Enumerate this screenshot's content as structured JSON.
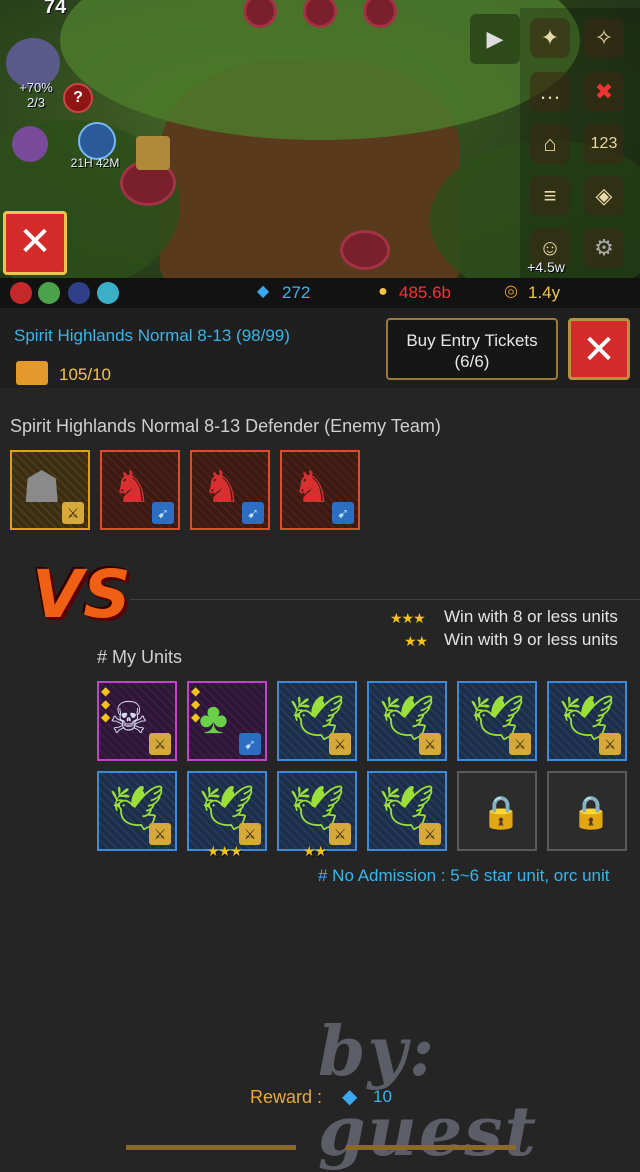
{
  "scene": {
    "level": "74",
    "boost_percent": "+70%",
    "boost_count": "2/3",
    "help_icon": "?",
    "timer": "21H 42M",
    "floating_gain": "+4.5w",
    "close_glyph": "✕"
  },
  "currency": {
    "gems": "272",
    "medals": "485.6b",
    "gold": "1.4y",
    "gem_icon": "gem-icon",
    "medal_icon": "medal-icon",
    "gold_icon": "gold-coin-icon"
  },
  "dungeon": {
    "title": "Spirit Highlands Normal 8-13 (98/99)",
    "tickets": "105/10",
    "buy_label": "Buy Entry Tickets",
    "buy_count": "(6/6)",
    "close_glyph": "✕"
  },
  "enemy": {
    "heading": "Spirit Highlands Normal 8-13 Defender (Enemy Team)"
  },
  "vs_label": "VS",
  "rules": {
    "three_star": "Win with 8 or less units",
    "two_star": "Win with 9 or less units",
    "three_star_icon": "★★★",
    "two_star_icon": "★★"
  },
  "my_units": {
    "heading": "# My Units",
    "row1_stars": "★★★",
    "row2_stars": "★★"
  },
  "restriction": "# No Admission : 5~6 star unit, orc unit",
  "reward": {
    "label": "Reward :",
    "value": "10"
  },
  "watermark": "by: guest",
  "colors": {
    "accent_blue": "#39b5ec",
    "gold": "#f2c34a",
    "danger_red": "#d42a2a",
    "medal_red": "#ff3030"
  }
}
